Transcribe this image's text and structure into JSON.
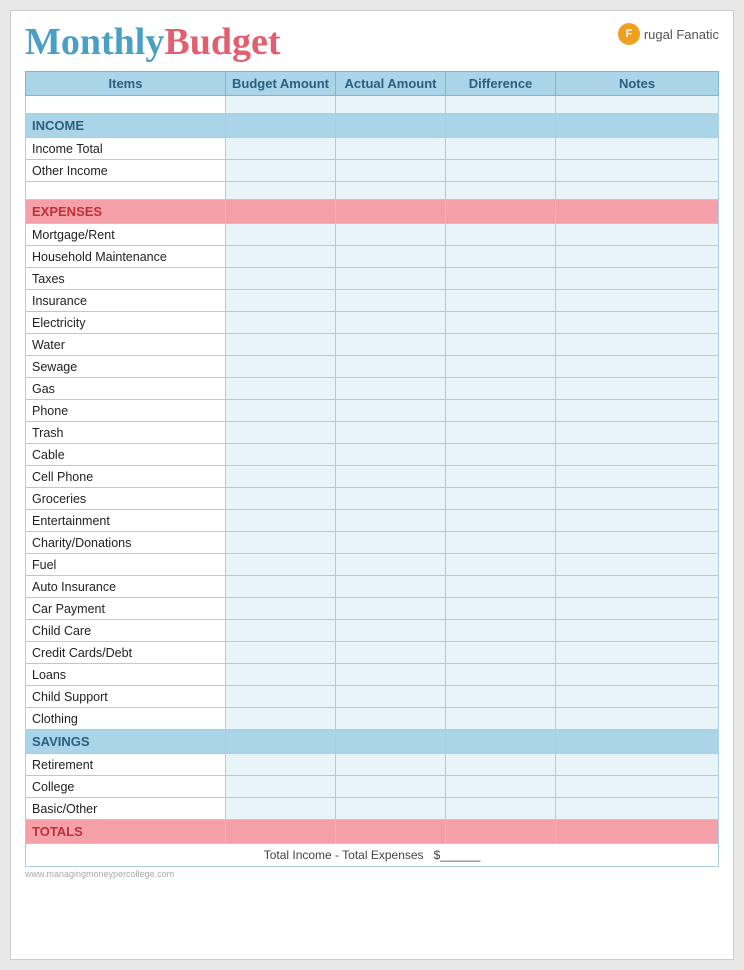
{
  "header": {
    "title_monthly": "Monthly",
    "title_budget": "Budget",
    "brand_icon": "F",
    "brand_name": "rugal Fanatic"
  },
  "columns": {
    "items": "Items",
    "budget_amount": "Budget Amount",
    "actual_amount": "Actual Amount",
    "difference": "Difference",
    "notes": "Notes"
  },
  "sections": {
    "income": "INCOME",
    "expenses": "EXPENSES",
    "savings": "SAVINGS",
    "totals": "TOTALS"
  },
  "income_items": [
    "Income Total",
    "Other Income"
  ],
  "expense_items": [
    "Mortgage/Rent",
    "Household Maintenance",
    "Taxes",
    "Insurance",
    "Electricity",
    "Water",
    "Sewage",
    "Gas",
    "Phone",
    "Trash",
    "Cable",
    "Cell Phone",
    "Groceries",
    "Entertainment",
    "Charity/Donations",
    "Fuel",
    "Auto Insurance",
    "Car Payment",
    "Child Care",
    "Credit Cards/Debt",
    "Loans",
    "Child Support",
    "Clothing"
  ],
  "savings_items": [
    "Retirement",
    "College",
    "Basic/Other"
  ],
  "footer": {
    "formula": "Total Income  -  Total Expenses",
    "dollar": "$______"
  },
  "watermark": "www.managingmoneypercollege.com"
}
